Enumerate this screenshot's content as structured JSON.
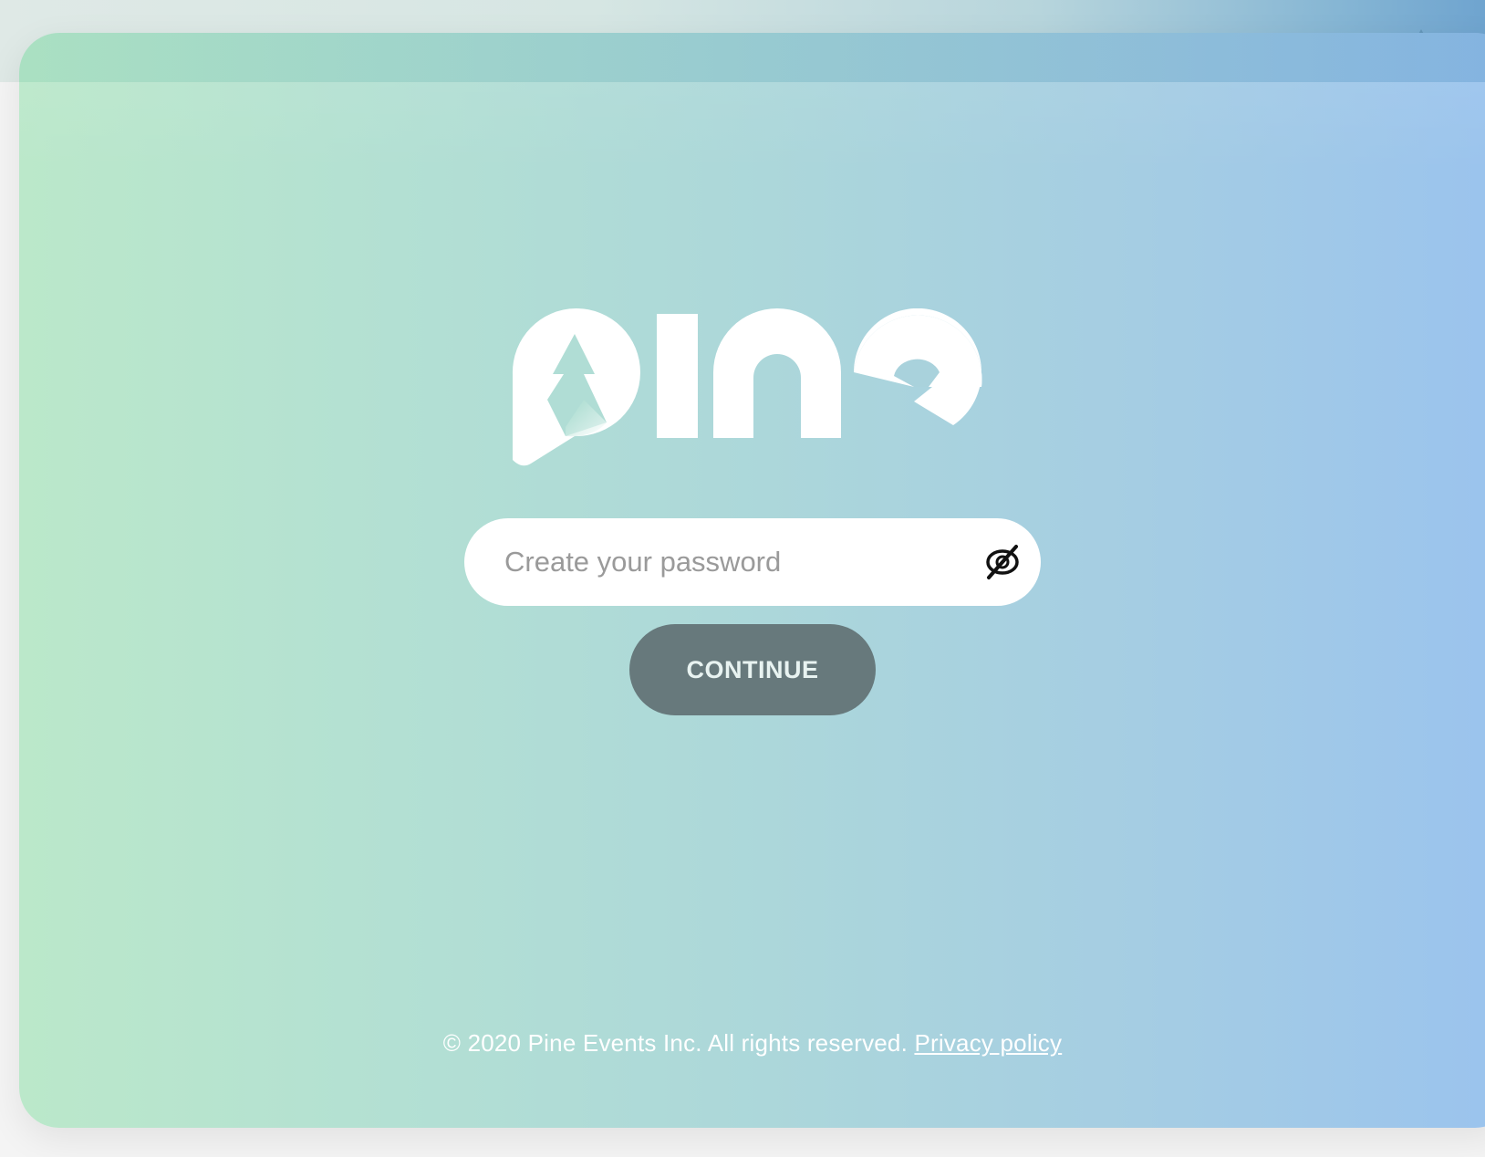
{
  "brand": {
    "logo_text": "pine",
    "logo_color": "#ffffff"
  },
  "password": {
    "placeholder": "Create your password",
    "value": "",
    "toggle_icon": "eye-off-icon"
  },
  "continue_button": {
    "label": "CONTINUE",
    "background": "#67797c"
  },
  "footer": {
    "copyright": "© 2020 Pine Events Inc. All rights reserved.",
    "privacy_link": "Privacy policy"
  },
  "colors": {
    "gradient_left": "#bbe8ca",
    "gradient_right": "#9ac3ee"
  }
}
